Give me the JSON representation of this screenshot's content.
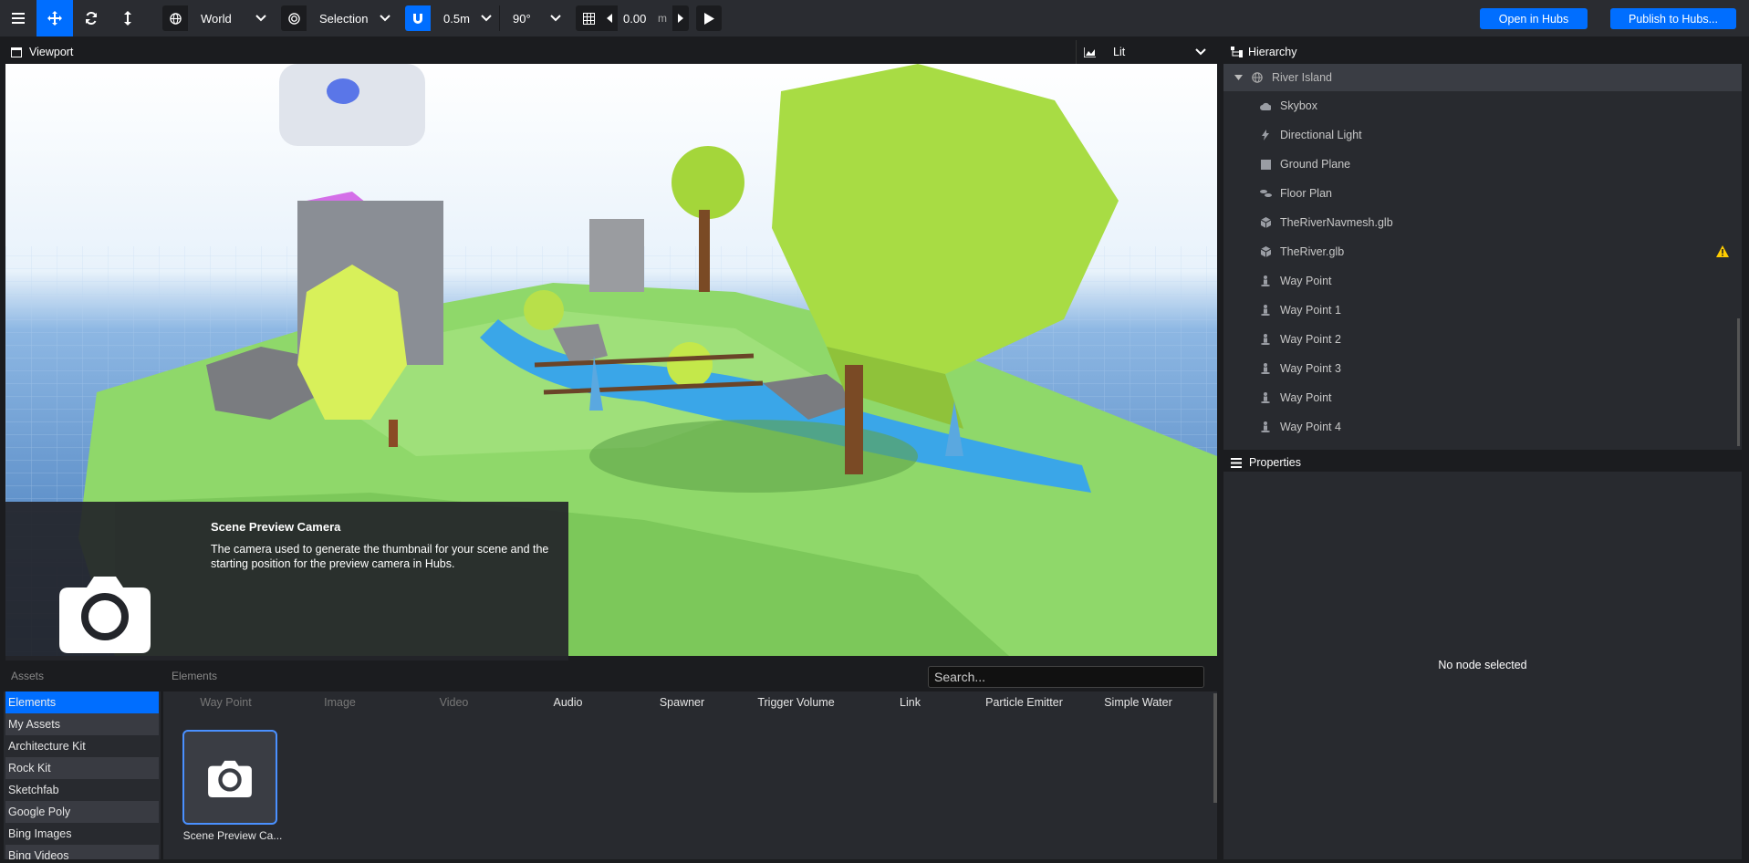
{
  "toolbar": {
    "space_select": "World",
    "pivot_select": "Selection",
    "snap_translate": "0.5m",
    "snap_rotate": "90°",
    "grid_height": "0.00",
    "grid_unit": "m",
    "open_hubs": "Open in Hubs",
    "publish_hubs": "Publish to Hubs..."
  },
  "viewport": {
    "title": "Viewport",
    "render_mode": "Lit"
  },
  "hierarchy": {
    "title": "Hierarchy",
    "root": "River Island",
    "items": [
      {
        "label": "Skybox",
        "icon": "cloud-icon"
      },
      {
        "label": "Directional Light",
        "icon": "bolt-icon"
      },
      {
        "label": "Ground Plane",
        "icon": "square-icon"
      },
      {
        "label": "Floor Plan",
        "icon": "shoe-prints-icon"
      },
      {
        "label": "TheRiverNavmesh.glb",
        "icon": "cube-icon"
      },
      {
        "label": "TheRiver.glb",
        "icon": "cube-icon",
        "warning": true
      },
      {
        "label": "Way Point",
        "icon": "street-view-icon"
      },
      {
        "label": "Way Point 1",
        "icon": "street-view-icon"
      },
      {
        "label": "Way Point 2",
        "icon": "street-view-icon"
      },
      {
        "label": "Way Point 3",
        "icon": "street-view-icon"
      },
      {
        "label": "Way Point",
        "icon": "street-view-icon"
      },
      {
        "label": "Way Point 4",
        "icon": "street-view-icon"
      }
    ]
  },
  "properties": {
    "title": "Properties",
    "empty": "No node selected"
  },
  "assets": {
    "col1_header": "Assets",
    "col2_header": "Elements",
    "search_placeholder": "Search...",
    "sources": [
      "Elements",
      "My Assets",
      "Architecture Kit",
      "Rock Kit",
      "Sketchfab",
      "Google Poly",
      "Bing Images",
      "Bing Videos"
    ],
    "element_types": [
      "Way Point",
      "Image",
      "Video",
      "Audio",
      "Spawner",
      "Trigger Volume",
      "Link",
      "Particle Emitter",
      "Simple Water"
    ],
    "tile_label": "Scene Preview Ca..."
  },
  "tooltip": {
    "title": "Scene Preview Camera",
    "description": "The camera used to generate the thumbnail for your scene and the starting position for the preview camera in Hubs."
  },
  "colors": {
    "accent": "#006eff",
    "panel": "#282a2f",
    "background": "#1b1c1f",
    "warning": "#ffcc00"
  }
}
